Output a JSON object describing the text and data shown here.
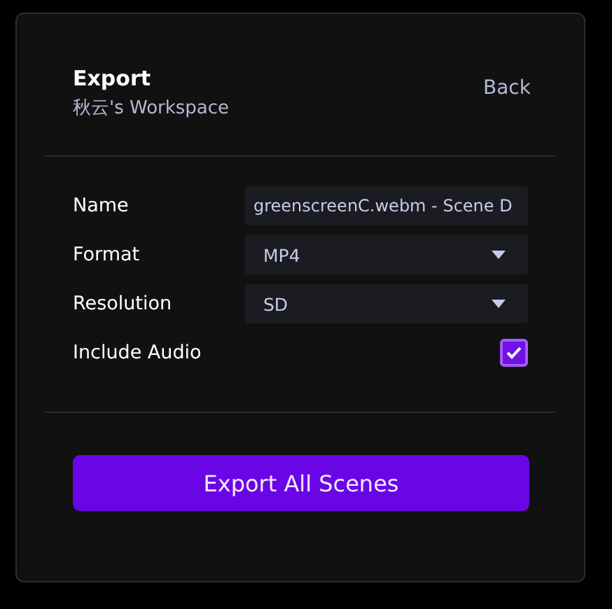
{
  "header": {
    "title": "Export",
    "subtitle": "秋云's Workspace",
    "back_link": "Back"
  },
  "fields": [
    {
      "kind": "text",
      "label": "Name",
      "value": "greenscreenC.webm - Scene D"
    },
    {
      "kind": "select",
      "label": "Format",
      "value": "MP4"
    },
    {
      "kind": "select",
      "label": "Resolution",
      "value": "SD"
    },
    {
      "kind": "checkbox",
      "label": "Include Audio",
      "checked": true
    }
  ],
  "primary_button": "Export All Scenes"
}
